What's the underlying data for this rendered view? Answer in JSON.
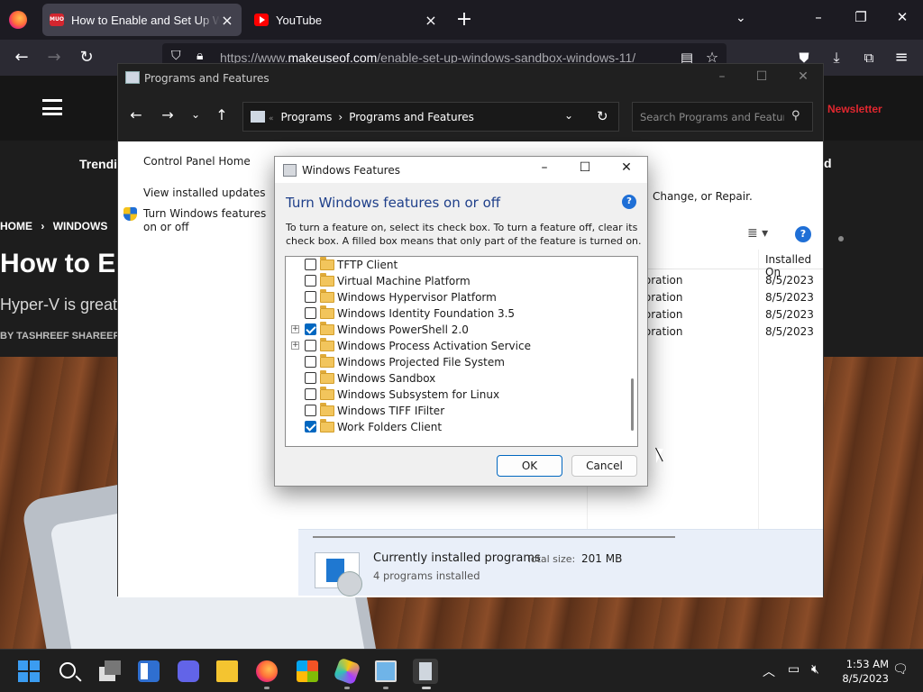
{
  "browser": {
    "tabs": [
      {
        "title": "How to Enable and Set Up Windows Sandbox",
        "favicon": "muo",
        "active": true
      },
      {
        "title": "YouTube",
        "favicon": "youtube",
        "active": false
      }
    ],
    "url_prefix": "https://www.",
    "url_domain": "makeuseof.com",
    "url_path": "/enable-set-up-windows-sandbox-windows-11/"
  },
  "website": {
    "newsletter": "Newsletter",
    "trending": "Trendin",
    "right_fragment": "d",
    "breadcrumb": [
      "HOME",
      "WINDOWS"
    ],
    "title": "How to E",
    "subtitle": "Hyper-V is great,",
    "byline": "BY TASHREEF SHAREEF"
  },
  "programs_features": {
    "title": "Programs and Features",
    "address": {
      "root": "Programs",
      "current": "Programs and Features"
    },
    "search_placeholder": "Search Programs and Features",
    "left_links": [
      "Control Panel Home",
      "View installed updates",
      "Turn Windows features on or off"
    ],
    "heading_tail": "l, Change, or Repair.",
    "column_installed_on": "Installed On",
    "rows": [
      {
        "publisher": "orporation",
        "installed": "8/5/2023"
      },
      {
        "publisher": "orporation",
        "installed": "8/5/2023"
      },
      {
        "publisher": "orporation",
        "installed": "8/5/2023"
      },
      {
        "publisher": "orporation",
        "installed": "8/5/2023"
      }
    ],
    "status": {
      "label": "Currently installed programs",
      "size_label": "Total size:",
      "size_value": "201 MB",
      "count": "4 programs installed"
    }
  },
  "windows_features": {
    "title": "Windows Features",
    "heading": "Turn Windows features on or off",
    "description": "To turn a feature on, select its check box. To turn a feature off, clear its check box. A filled box means that only part of the feature is turned on.",
    "items": [
      {
        "label": "TFTP Client",
        "checked": false,
        "expandable": false
      },
      {
        "label": "Virtual Machine Platform",
        "checked": false,
        "expandable": false
      },
      {
        "label": "Windows Hypervisor Platform",
        "checked": false,
        "expandable": false
      },
      {
        "label": "Windows Identity Foundation 3.5",
        "checked": false,
        "expandable": false
      },
      {
        "label": "Windows PowerShell 2.0",
        "checked": true,
        "expandable": true
      },
      {
        "label": "Windows Process Activation Service",
        "checked": false,
        "expandable": true
      },
      {
        "label": "Windows Projected File System",
        "checked": false,
        "expandable": false
      },
      {
        "label": "Windows Sandbox",
        "checked": false,
        "expandable": false
      },
      {
        "label": "Windows Subsystem for Linux",
        "checked": false,
        "expandable": false
      },
      {
        "label": "Windows TIFF IFilter",
        "checked": false,
        "expandable": false
      },
      {
        "label": "Work Folders Client",
        "checked": true,
        "expandable": false
      }
    ],
    "ok_label": "OK",
    "cancel_label": "Cancel"
  },
  "taskbar": {
    "time": "1:53 AM",
    "date": "8/5/2023"
  },
  "colors": {
    "accent": "#0067c0",
    "heading_blue": "#1e3f8a",
    "brand_red": "#e0272f"
  }
}
